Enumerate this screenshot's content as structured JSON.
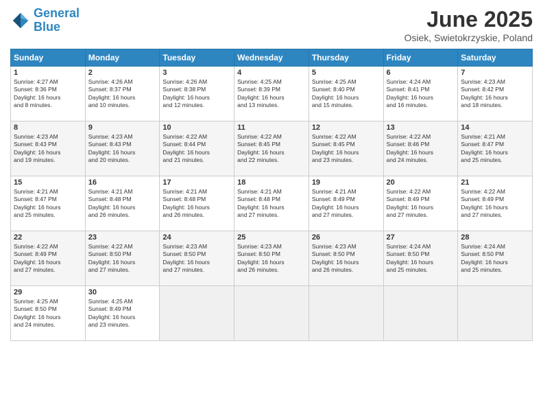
{
  "logo": {
    "line1": "General",
    "line2": "Blue"
  },
  "title": "June 2025",
  "location": "Osiek, Swietokrzyskie, Poland",
  "headers": [
    "Sunday",
    "Monday",
    "Tuesday",
    "Wednesday",
    "Thursday",
    "Friday",
    "Saturday"
  ],
  "rows": [
    [
      {
        "day": "1",
        "info": "Sunrise: 4:27 AM\nSunset: 8:36 PM\nDaylight: 16 hours\nand 8 minutes."
      },
      {
        "day": "2",
        "info": "Sunrise: 4:26 AM\nSunset: 8:37 PM\nDaylight: 16 hours\nand 10 minutes."
      },
      {
        "day": "3",
        "info": "Sunrise: 4:26 AM\nSunset: 8:38 PM\nDaylight: 16 hours\nand 12 minutes."
      },
      {
        "day": "4",
        "info": "Sunrise: 4:25 AM\nSunset: 8:39 PM\nDaylight: 16 hours\nand 13 minutes."
      },
      {
        "day": "5",
        "info": "Sunrise: 4:25 AM\nSunset: 8:40 PM\nDaylight: 16 hours\nand 15 minutes."
      },
      {
        "day": "6",
        "info": "Sunrise: 4:24 AM\nSunset: 8:41 PM\nDaylight: 16 hours\nand 16 minutes."
      },
      {
        "day": "7",
        "info": "Sunrise: 4:23 AM\nSunset: 8:42 PM\nDaylight: 16 hours\nand 18 minutes."
      }
    ],
    [
      {
        "day": "8",
        "info": "Sunrise: 4:23 AM\nSunset: 8:43 PM\nDaylight: 16 hours\nand 19 minutes."
      },
      {
        "day": "9",
        "info": "Sunrise: 4:23 AM\nSunset: 8:43 PM\nDaylight: 16 hours\nand 20 minutes."
      },
      {
        "day": "10",
        "info": "Sunrise: 4:22 AM\nSunset: 8:44 PM\nDaylight: 16 hours\nand 21 minutes."
      },
      {
        "day": "11",
        "info": "Sunrise: 4:22 AM\nSunset: 8:45 PM\nDaylight: 16 hours\nand 22 minutes."
      },
      {
        "day": "12",
        "info": "Sunrise: 4:22 AM\nSunset: 8:45 PM\nDaylight: 16 hours\nand 23 minutes."
      },
      {
        "day": "13",
        "info": "Sunrise: 4:22 AM\nSunset: 8:46 PM\nDaylight: 16 hours\nand 24 minutes."
      },
      {
        "day": "14",
        "info": "Sunrise: 4:21 AM\nSunset: 8:47 PM\nDaylight: 16 hours\nand 25 minutes."
      }
    ],
    [
      {
        "day": "15",
        "info": "Sunrise: 4:21 AM\nSunset: 8:47 PM\nDaylight: 16 hours\nand 25 minutes."
      },
      {
        "day": "16",
        "info": "Sunrise: 4:21 AM\nSunset: 8:48 PM\nDaylight: 16 hours\nand 26 minutes."
      },
      {
        "day": "17",
        "info": "Sunrise: 4:21 AM\nSunset: 8:48 PM\nDaylight: 16 hours\nand 26 minutes."
      },
      {
        "day": "18",
        "info": "Sunrise: 4:21 AM\nSunset: 8:48 PM\nDaylight: 16 hours\nand 27 minutes."
      },
      {
        "day": "19",
        "info": "Sunrise: 4:21 AM\nSunset: 8:49 PM\nDaylight: 16 hours\nand 27 minutes."
      },
      {
        "day": "20",
        "info": "Sunrise: 4:22 AM\nSunset: 8:49 PM\nDaylight: 16 hours\nand 27 minutes."
      },
      {
        "day": "21",
        "info": "Sunrise: 4:22 AM\nSunset: 8:49 PM\nDaylight: 16 hours\nand 27 minutes."
      }
    ],
    [
      {
        "day": "22",
        "info": "Sunrise: 4:22 AM\nSunset: 8:49 PM\nDaylight: 16 hours\nand 27 minutes."
      },
      {
        "day": "23",
        "info": "Sunrise: 4:22 AM\nSunset: 8:50 PM\nDaylight: 16 hours\nand 27 minutes."
      },
      {
        "day": "24",
        "info": "Sunrise: 4:23 AM\nSunset: 8:50 PM\nDaylight: 16 hours\nand 27 minutes."
      },
      {
        "day": "25",
        "info": "Sunrise: 4:23 AM\nSunset: 8:50 PM\nDaylight: 16 hours\nand 26 minutes."
      },
      {
        "day": "26",
        "info": "Sunrise: 4:23 AM\nSunset: 8:50 PM\nDaylight: 16 hours\nand 26 minutes."
      },
      {
        "day": "27",
        "info": "Sunrise: 4:24 AM\nSunset: 8:50 PM\nDaylight: 16 hours\nand 25 minutes."
      },
      {
        "day": "28",
        "info": "Sunrise: 4:24 AM\nSunset: 8:50 PM\nDaylight: 16 hours\nand 25 minutes."
      }
    ],
    [
      {
        "day": "29",
        "info": "Sunrise: 4:25 AM\nSunset: 8:50 PM\nDaylight: 16 hours\nand 24 minutes."
      },
      {
        "day": "30",
        "info": "Sunrise: 4:25 AM\nSunset: 8:49 PM\nDaylight: 16 hours\nand 23 minutes."
      },
      {
        "day": "",
        "info": ""
      },
      {
        "day": "",
        "info": ""
      },
      {
        "day": "",
        "info": ""
      },
      {
        "day": "",
        "info": ""
      },
      {
        "day": "",
        "info": ""
      }
    ]
  ]
}
